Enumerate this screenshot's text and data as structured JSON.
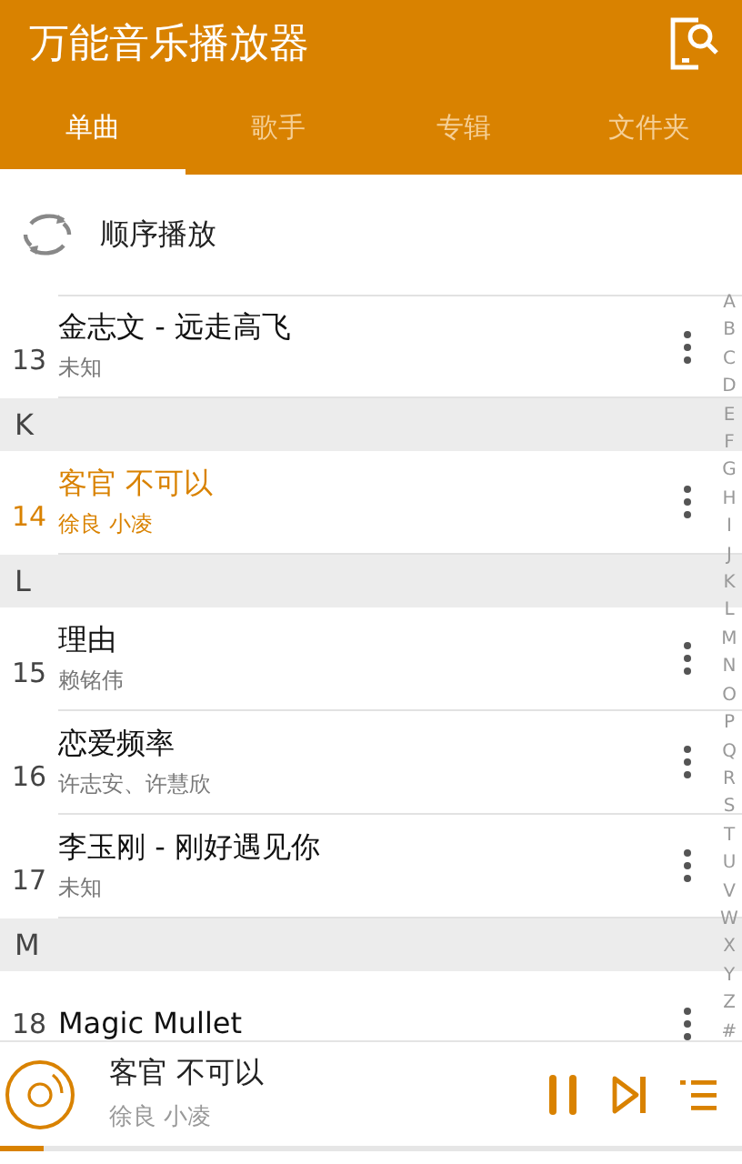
{
  "app_bar": {
    "title": "万能音乐播放器"
  },
  "tabs": [
    {
      "label": "单曲",
      "selected": true
    },
    {
      "label": "歌手",
      "selected": false
    },
    {
      "label": "专辑",
      "selected": false
    },
    {
      "label": "文件夹",
      "selected": false
    }
  ],
  "play_mode": {
    "label": "顺序播放"
  },
  "songs": [
    {
      "kind": "song",
      "number": "13",
      "title": "金志文 - 远走高飞",
      "artist": "未知",
      "selected": false
    },
    {
      "kind": "section",
      "letter": "K"
    },
    {
      "kind": "song",
      "number": "14",
      "title": "客官 不可以",
      "artist": "徐良 小凌",
      "selected": true
    },
    {
      "kind": "section",
      "letter": "L"
    },
    {
      "kind": "song",
      "number": "15",
      "title": "理由",
      "artist": "赖铭伟",
      "selected": false
    },
    {
      "kind": "song",
      "number": "16",
      "title": "恋爱频率",
      "artist": "许志安、许慧欣",
      "selected": false
    },
    {
      "kind": "song",
      "number": "17",
      "title": "李玉刚 - 刚好遇见你",
      "artist": "未知",
      "selected": false
    },
    {
      "kind": "section",
      "letter": "M"
    },
    {
      "kind": "song",
      "number": "18",
      "title": "Magic Mullet",
      "selected": false
    }
  ],
  "index_bar": [
    "A",
    "B",
    "C",
    "D",
    "E",
    "F",
    "G",
    "H",
    "I",
    "J",
    "K",
    "L",
    "M",
    "N",
    "O",
    "P",
    "Q",
    "R",
    "S",
    "T",
    "U",
    "V",
    "W",
    "X",
    "Y",
    "Z",
    "#"
  ],
  "now_playing": {
    "title": "客官 不可以",
    "artist": "徐良 小凌",
    "level": 0.06
  }
}
